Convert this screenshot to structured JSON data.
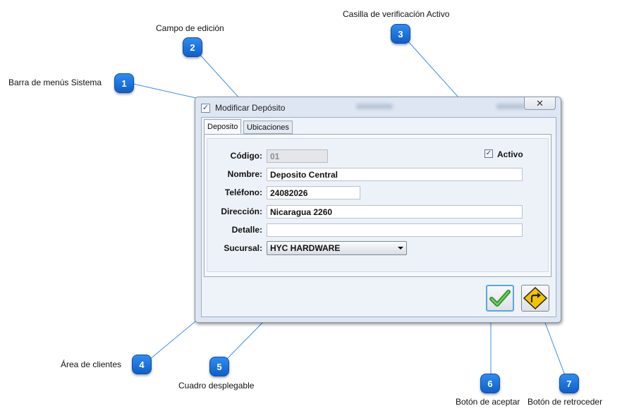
{
  "callouts": [
    {
      "number": "1",
      "label": "Barra de menús Sistema"
    },
    {
      "number": "2",
      "label": "Campo de edición"
    },
    {
      "number": "3",
      "label": "Casilla de verificación Activo"
    },
    {
      "number": "4",
      "label": "Área de clientes"
    },
    {
      "number": "5",
      "label": "Cuadro desplegable"
    },
    {
      "number": "6",
      "label": "Botón de aceptar"
    },
    {
      "number": "7",
      "label": "Botón de retroceder"
    }
  ],
  "window": {
    "title": "Modificar Depósito",
    "close_glyph": "✕"
  },
  "tabs": [
    "Deposito",
    "Ubicaciones"
  ],
  "form": {
    "codigo_label": "Código:",
    "codigo_value": "01",
    "nombre_label": "Nombre:",
    "nombre_value": "Deposito Central",
    "telefono_label": "Teléfono:",
    "telefono_value": "24082026",
    "direccion_label": "Dirección:",
    "direccion_value": "Nicaragua 2260",
    "detalle_label": "Detalle:",
    "detalle_value": "",
    "sucursal_label": "Sucursal:",
    "sucursal_value": "HYC HARDWARE",
    "activo_label": "Activo",
    "activo_checked": true
  },
  "buttons": {
    "accept_icon": "checkmark-icon",
    "back_icon": "turn-right-sign-icon"
  },
  "colors": {
    "callout_badge": "#1874e0",
    "callout_line": "#3a8fe6",
    "accept_green": "#3aa83a",
    "back_yellow": "#f5c400"
  }
}
